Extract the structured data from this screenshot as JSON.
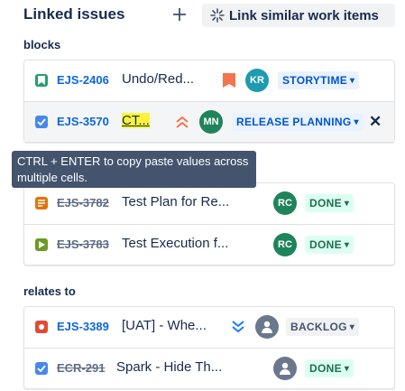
{
  "header": {
    "title": "Linked issues",
    "add_icon": "plus-icon",
    "link_similar_label": "Link similar work items",
    "link_similar_icon": "sparkle-icon"
  },
  "sections": [
    {
      "label": "blocks",
      "items": [
        {
          "key": "EJS-2406",
          "summary": "Undo/Red...",
          "type": "story",
          "priority": "high-flag",
          "assignee": "KR",
          "status": "STORYTIME",
          "resolved": false
        },
        {
          "key": "EJS-3570",
          "summary": "CT...",
          "type": "task",
          "priority": "highest",
          "assignee": "MN",
          "status": "RELEASE PLANNING",
          "resolved": false,
          "highlighted": true
        }
      ]
    },
    {
      "label": "",
      "items": [
        {
          "key": "EJS-3782",
          "summary": "Test Plan for Re...",
          "type": "test-plan",
          "assignee": "RC",
          "status": "DONE",
          "resolved": true
        },
        {
          "key": "EJS-3783",
          "summary": "Test Execution f...",
          "type": "test-execution",
          "assignee": "RC",
          "status": "DONE",
          "resolved": true
        }
      ]
    },
    {
      "label": "relates to",
      "items": [
        {
          "key": "EJS-3389",
          "summary": "[UAT] - Whe...",
          "type": "bug",
          "priority": "lowest",
          "assignee": "",
          "status": "BACKLOG",
          "resolved": false
        },
        {
          "key": "ECR-291",
          "summary": "Spark - Hide Th...",
          "type": "task",
          "assignee": "",
          "status": "DONE",
          "resolved": true
        }
      ]
    }
  ],
  "tooltip": "CTRL + ENTER to copy paste values across multiple cells.",
  "colors": {
    "link_blue": "#0c66e4",
    "avatar_kr": "#1d9bb0",
    "avatar_mn": "#1f845a",
    "avatar_rc": "#1f845a",
    "story": "#22a06b",
    "task": "#4688ec",
    "test_plan": "#e2740a",
    "test_execution": "#6a9a23",
    "bug": "#e34935",
    "highlight": "#fbf33a"
  }
}
